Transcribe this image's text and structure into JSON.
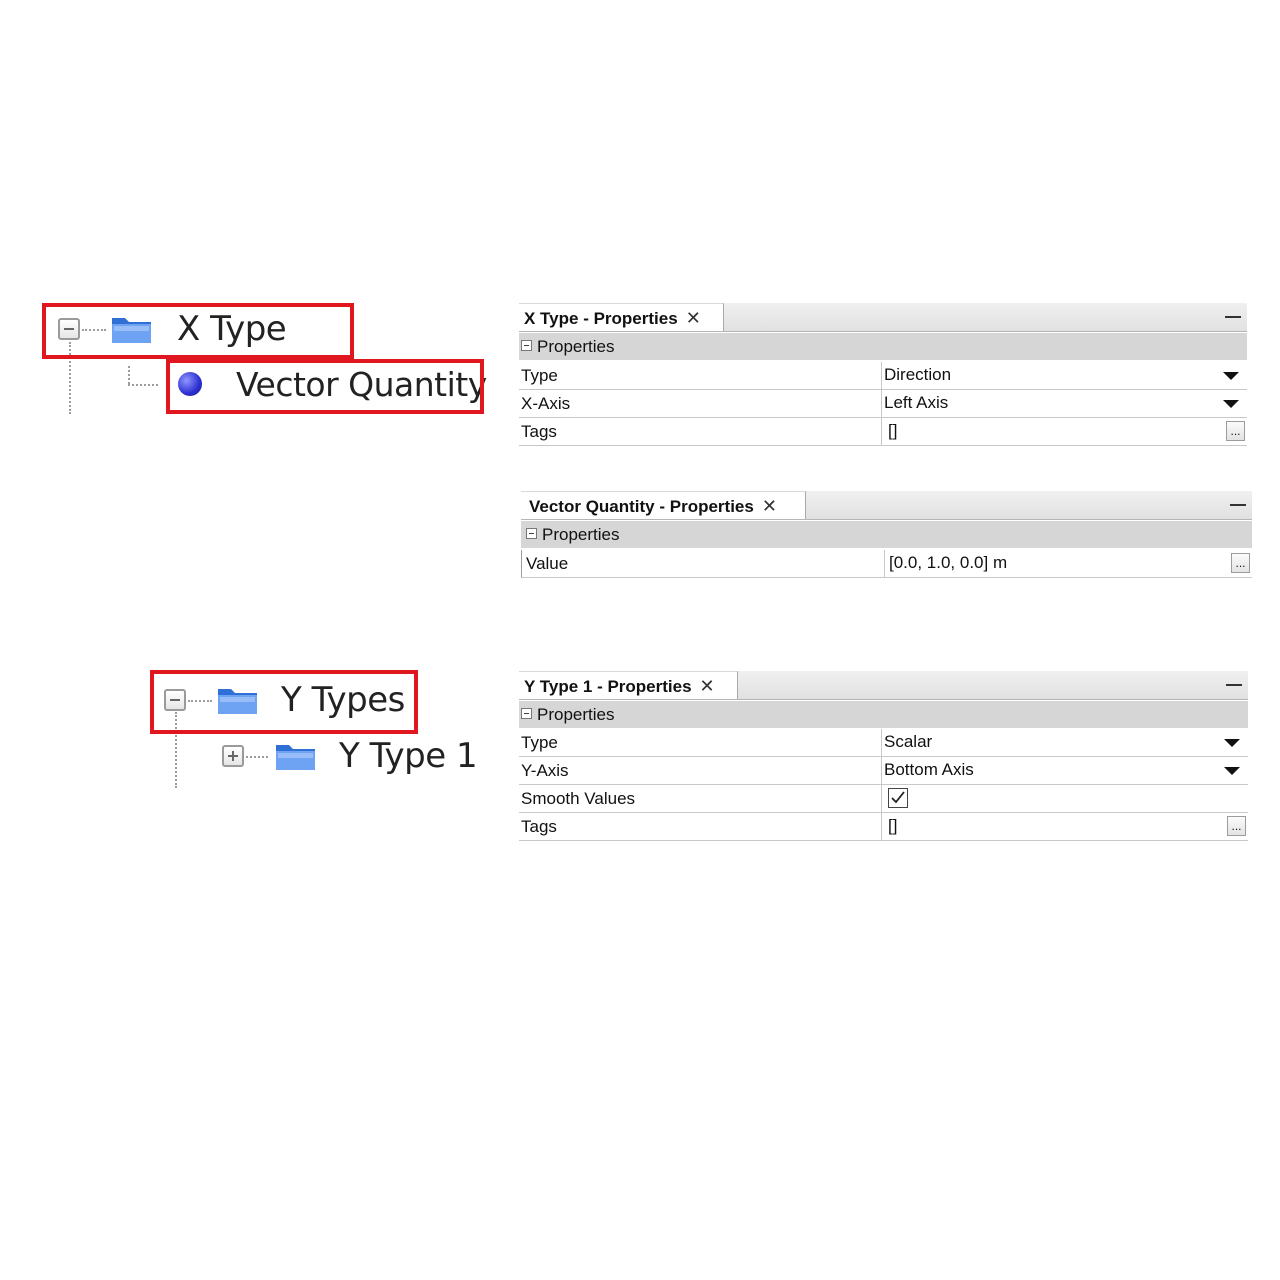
{
  "tree1": {
    "parent_label": "X Type",
    "child_label": "Vector Quantity",
    "toggle_icon": "minus-box-icon",
    "folder_icon": "folder-icon",
    "child_icon": "blue-bullet-icon"
  },
  "tree2": {
    "parent_label": "Y Types",
    "child_label": "Y Type 1",
    "toggle_icon": "minus-box-icon",
    "child_toggle_icon": "plus-box-icon",
    "folder_icon": "folder-icon"
  },
  "highlight_color": "#e0171f",
  "panel1": {
    "tab_title": "X Type - Properties",
    "close_glyph": "✕",
    "section_label": "Properties",
    "rows": [
      {
        "key": "Type",
        "value": "Direction"
      },
      {
        "key": "X-Axis",
        "value": "Left Axis"
      },
      {
        "key": "Tags",
        "value": "[]"
      }
    ],
    "ellipsis_label": "..."
  },
  "panel2": {
    "tab_title": "Vector Quantity - Properties",
    "close_glyph": "✕",
    "section_label": "Properties",
    "rows": [
      {
        "key": "Value",
        "value": "[0.0, 1.0, 0.0] m"
      }
    ],
    "ellipsis_label": "..."
  },
  "panel3": {
    "tab_title": "Y Type 1 - Properties",
    "close_glyph": "✕",
    "section_label": "Properties",
    "rows": [
      {
        "key": "Type",
        "value": "Scalar"
      },
      {
        "key": "Y-Axis",
        "value": "Bottom Axis"
      },
      {
        "key": "Smooth Values",
        "value": "",
        "checked": true
      },
      {
        "key": "Tags",
        "value": "[]"
      }
    ],
    "ellipsis_label": "..."
  }
}
